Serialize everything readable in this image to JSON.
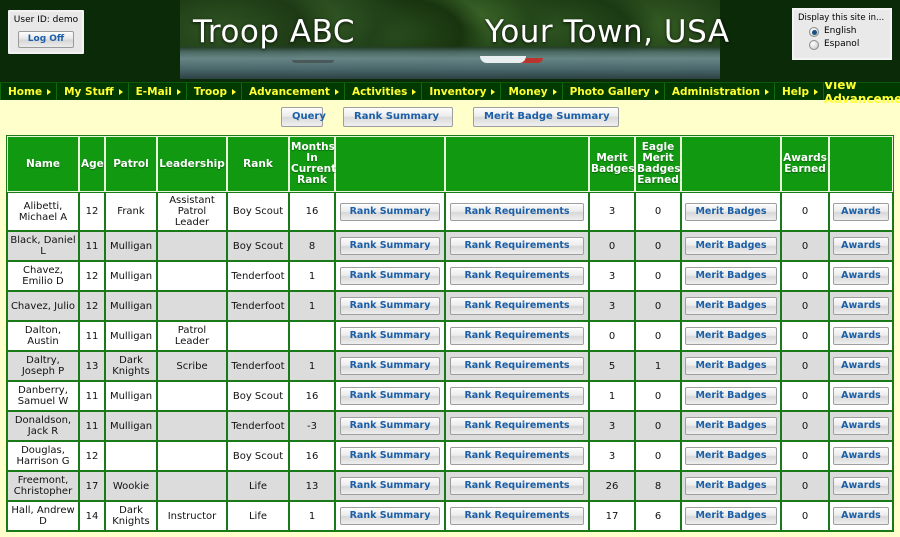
{
  "header": {
    "user_label": "User ID:  demo",
    "logoff_label": "Log Off",
    "troop_name": "Troop ABC",
    "town_name": "Your Town, USA",
    "language_box_title": "Display this site in...",
    "language_options": [
      {
        "label": "English",
        "selected": true
      },
      {
        "label": "Espanol",
        "selected": false
      }
    ],
    "page_title": "View Advancement"
  },
  "nav": {
    "items": [
      {
        "label": "Home"
      },
      {
        "label": "My Stuff"
      },
      {
        "label": "E-Mail"
      },
      {
        "label": "Troop"
      },
      {
        "label": "Advancement"
      },
      {
        "label": "Activities"
      },
      {
        "label": "Inventory"
      },
      {
        "label": "Money"
      },
      {
        "label": "Photo Gallery"
      },
      {
        "label": "Administration"
      },
      {
        "label": "Help"
      }
    ]
  },
  "toolbar": {
    "query_label": "Query",
    "rank_summary_label": "Rank Summary",
    "merit_badge_summary_label": "Merit Badge Summary"
  },
  "table": {
    "headers": [
      "Name",
      "Age",
      "Patrol",
      "Leadership",
      "Rank",
      "Months In Current Rank",
      "",
      "",
      "Merit Badges",
      "Eagle Merit Badges Earned",
      "",
      "Awards Earned",
      ""
    ],
    "row_button_labels": {
      "rank_summary": "Rank Summary",
      "rank_requirements": "Rank Requirements",
      "merit_badges": "Merit Badges",
      "awards": "Awards"
    },
    "rows": [
      {
        "name": "Alibetti, Michael A",
        "age": "12",
        "patrol": "Frank",
        "leadership": "Assistant Patrol Leader",
        "rank": "Boy Scout",
        "months": "16",
        "merit_badges": "3",
        "eagle_merit_badges": "0",
        "awards_earned": "0"
      },
      {
        "name": "Black, Daniel L",
        "age": "11",
        "patrol": "Mulligan",
        "leadership": "",
        "rank": "Boy Scout",
        "months": "8",
        "merit_badges": "0",
        "eagle_merit_badges": "0",
        "awards_earned": "0"
      },
      {
        "name": "Chavez, Emilio D",
        "age": "12",
        "patrol": "Mulligan",
        "leadership": "",
        "rank": "Tenderfoot",
        "months": "1",
        "merit_badges": "3",
        "eagle_merit_badges": "0",
        "awards_earned": "0"
      },
      {
        "name": "Chavez, Julio",
        "age": "12",
        "patrol": "Mulligan",
        "leadership": "",
        "rank": "Tenderfoot",
        "months": "1",
        "merit_badges": "3",
        "eagle_merit_badges": "0",
        "awards_earned": "0"
      },
      {
        "name": "Dalton, Austin",
        "age": "11",
        "patrol": "Mulligan",
        "leadership": "Patrol Leader",
        "rank": "",
        "months": "",
        "merit_badges": "0",
        "eagle_merit_badges": "0",
        "awards_earned": "0"
      },
      {
        "name": "Daltry, Joseph P",
        "age": "13",
        "patrol": "Dark Knights",
        "leadership": "Scribe",
        "rank": "Tenderfoot",
        "months": "1",
        "merit_badges": "5",
        "eagle_merit_badges": "1",
        "awards_earned": "0"
      },
      {
        "name": "Danberry, Samuel W",
        "age": "11",
        "patrol": "Mulligan",
        "leadership": "",
        "rank": "Boy Scout",
        "months": "16",
        "merit_badges": "1",
        "eagle_merit_badges": "0",
        "awards_earned": "0"
      },
      {
        "name": "Donaldson, Jack R",
        "age": "11",
        "patrol": "Mulligan",
        "leadership": "",
        "rank": "Tenderfoot",
        "months": "-3",
        "merit_badges": "3",
        "eagle_merit_badges": "0",
        "awards_earned": "0"
      },
      {
        "name": "Douglas, Harrison G",
        "age": "12",
        "patrol": "",
        "leadership": "",
        "rank": "Boy Scout",
        "months": "16",
        "merit_badges": "3",
        "eagle_merit_badges": "0",
        "awards_earned": "0"
      },
      {
        "name": "Freemont, Christopher",
        "age": "17",
        "patrol": "Wookie",
        "leadership": "",
        "rank": "Life",
        "months": "13",
        "merit_badges": "26",
        "eagle_merit_badges": "8",
        "awards_earned": "0"
      },
      {
        "name": "Hall, Andrew D",
        "age": "14",
        "patrol": "Dark Knights",
        "leadership": "Instructor",
        "rank": "Life",
        "months": "1",
        "merit_badges": "17",
        "eagle_merit_badges": "6",
        "awards_earned": "0"
      }
    ]
  },
  "colors": {
    "page_background": "#FFFFCC",
    "nav_background": "#013A01",
    "nav_text": "#FFFF33",
    "table_header_background": "#119911",
    "button_text": "#1B5FA8",
    "row_alt_background": "#DCDCDC"
  }
}
